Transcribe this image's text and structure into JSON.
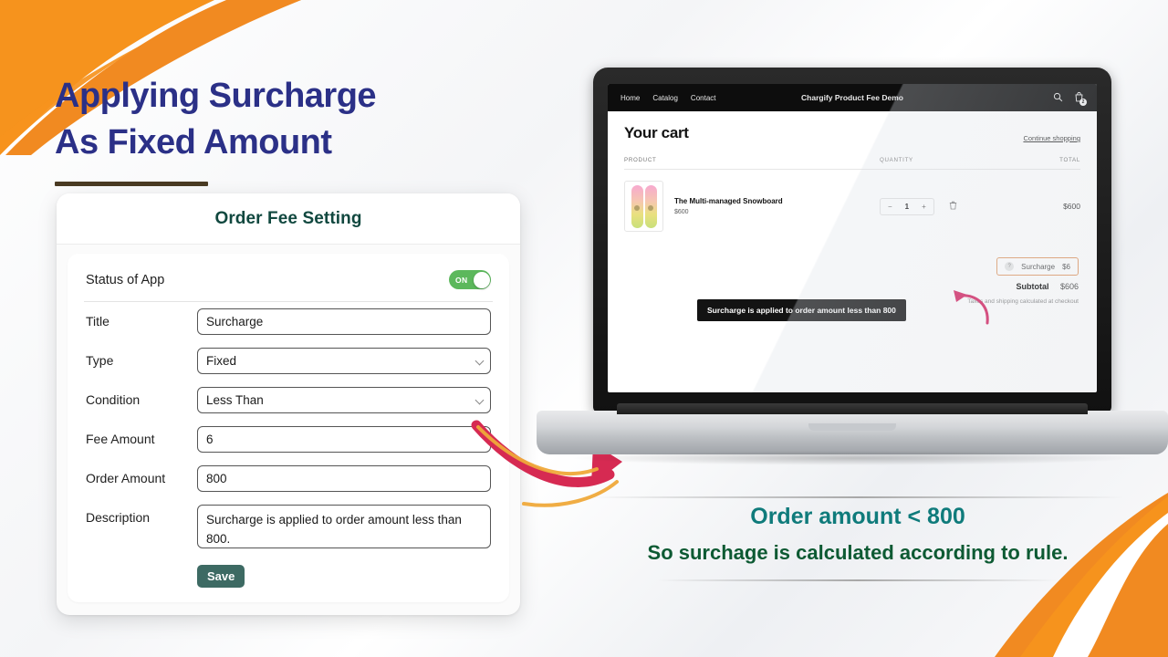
{
  "theme": {
    "headline_color": "#2b3087",
    "underline_color": "#4a3b23",
    "card_title_color": "#11483f",
    "toggle_on_color": "#5cb85c",
    "save_button_color": "#3d6a63",
    "accent_orange": "#f18a21",
    "arrow_crimson": "#d62a52",
    "caption_teal": "#0f7b7b",
    "caption_green": "#0d5a33",
    "surcharge_border": "#e39f6e"
  },
  "headline": {
    "line1": "Applying Surcharge",
    "line2": "As Fixed Amount"
  },
  "settings_card": {
    "title": "Order Fee Setting",
    "status_label": "Status of App",
    "status_toggle": "ON",
    "fields": [
      {
        "label": "Title",
        "value": "Surcharge",
        "control": "text"
      },
      {
        "label": "Type",
        "value": "Fixed",
        "control": "select"
      },
      {
        "label": "Condition",
        "value": "Less Than",
        "control": "select"
      },
      {
        "label": "Fee Amount",
        "value": "6",
        "control": "text"
      },
      {
        "label": "Order Amount",
        "value": "800",
        "control": "text"
      },
      {
        "label": "Description",
        "value": "Surcharge is applied to order amount less than 800.",
        "control": "textarea"
      }
    ],
    "save_label": "Save"
  },
  "store": {
    "nav_links": [
      "Home",
      "Catalog",
      "Contact"
    ],
    "brand": "Chargify Product Fee Demo",
    "search_icon": "search-icon",
    "cart_icon": "cart-bag-icon",
    "cart_count": "2",
    "cart_title": "Your cart",
    "continue_shopping": "Continue shopping",
    "columns": {
      "product": "PRODUCT",
      "quantity": "QUANTITY",
      "total": "TOTAL"
    },
    "line_item": {
      "title": "The Multi-managed Snowboard",
      "unit_price": "$600",
      "qty_minus": "−",
      "qty_value": "1",
      "qty_plus": "+",
      "remove_icon": "trash-icon",
      "line_total": "$600"
    },
    "totals": {
      "surcharge_label": "Surcharge",
      "surcharge_value": "$6",
      "help_icon": "question-mark-icon",
      "subtotal_label": "Subtotal",
      "subtotal_value": "$606",
      "tax_note": "Taxes and shipping calculated at checkout"
    },
    "tooltip": "Surcharge is applied to order amount less than 800"
  },
  "caption": {
    "line1": "Order amount < 800",
    "line2": "So surchage is calculated according to rule."
  }
}
